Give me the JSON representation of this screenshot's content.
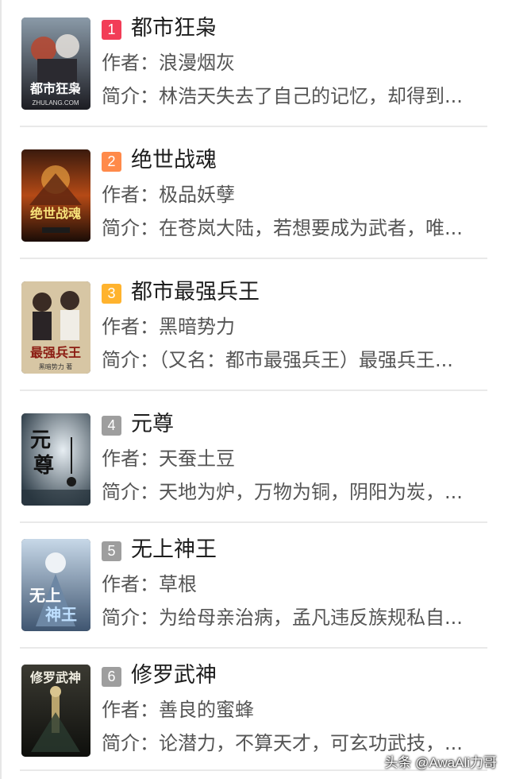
{
  "list": {
    "items": [
      {
        "rank": "1",
        "badge_color": "#f23d57",
        "title": "都市狂枭",
        "author": "作者：浪漫烟灰",
        "intro": "简介：林浩天失去了自己的记忆，却得到..."
      },
      {
        "rank": "2",
        "badge_color": "#ff8a4a",
        "title": "绝世战魂",
        "author": "作者：极品妖孽",
        "intro": "简介：在苍岚大陆，若想要成为武者，唯..."
      },
      {
        "rank": "3",
        "badge_color": "#ffb32e",
        "title": "都市最强兵王",
        "author": "作者：黑暗势力",
        "intro": "简介：（又名：都市最强兵王）最强兵王..."
      },
      {
        "rank": "4",
        "badge_color": "#9e9e9e",
        "title": "元尊",
        "author": "作者：天蚕土豆",
        "intro": "简介：天地为炉，万物为铜，阴阳为炭，..."
      },
      {
        "rank": "5",
        "badge_color": "#9e9e9e",
        "title": "无上神王",
        "author": "作者：草根",
        "intro": "简介：为给母亲治病，孟凡违反族规私自..."
      },
      {
        "rank": "6",
        "badge_color": "#9e9e9e",
        "title": "修罗武神",
        "author": "作者：善良的蜜蜂",
        "intro": "简介：论潜力，不算天才，可玄功武技，..."
      }
    ],
    "covers": [
      {
        "icon": "book-cover-dushi-kuangxiao",
        "text": "都市狂枭",
        "sub": "ZHULANG.COM"
      },
      {
        "icon": "book-cover-jueshi-zhanhun",
        "text": "绝世战魂",
        "sub": ""
      },
      {
        "icon": "book-cover-dushi-zuiqiang-bingwang",
        "text": "最强兵王",
        "sub": "黑暗势力 著"
      },
      {
        "icon": "book-cover-yuanzun",
        "text": "元尊",
        "sub": ""
      },
      {
        "icon": "book-cover-wushang-shenwang",
        "text": "无上神王",
        "sub": ""
      },
      {
        "icon": "book-cover-xiuluo-wushen",
        "text": "修罗武神",
        "sub": ""
      }
    ]
  },
  "watermark": "头条 @AwaAli力哥"
}
